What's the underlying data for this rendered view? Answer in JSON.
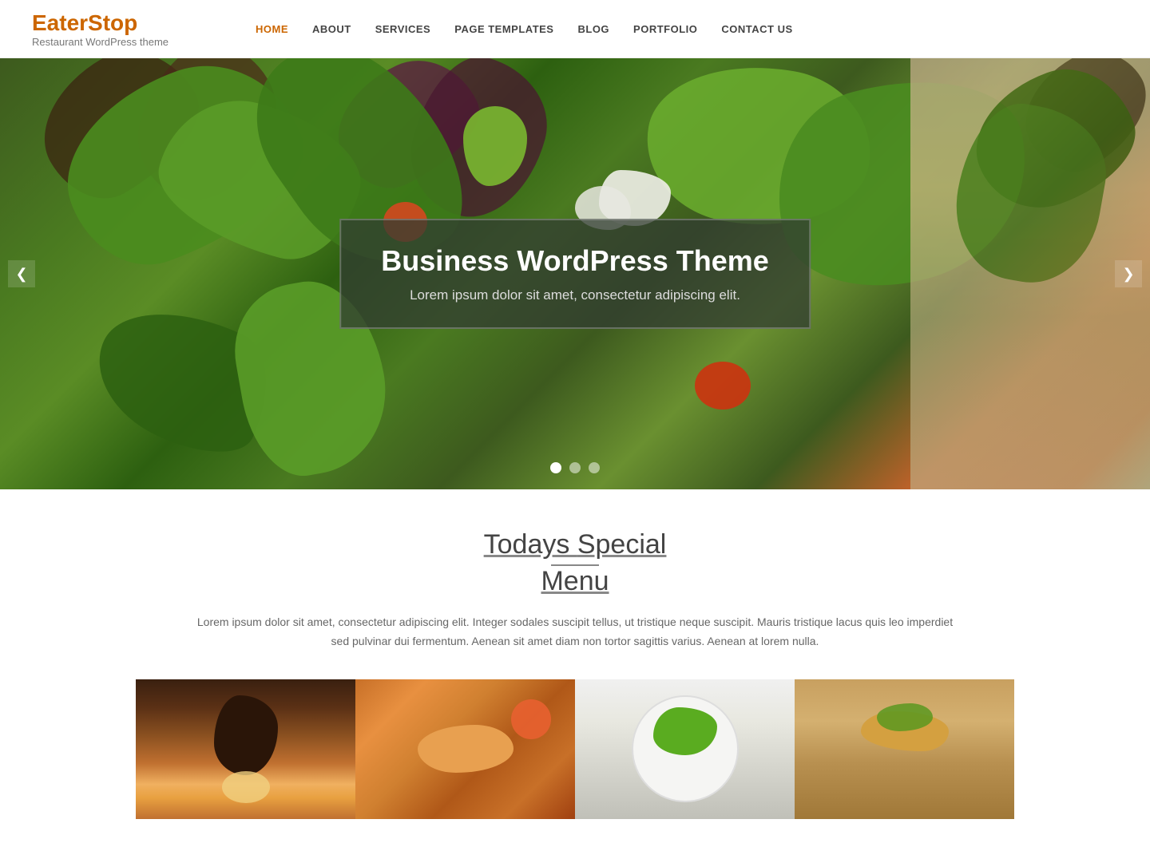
{
  "header": {
    "logo": {
      "title": "EaterStop",
      "subtitle": "Restaurant WordPress theme"
    },
    "nav": {
      "items": [
        {
          "label": "HOME",
          "active": true
        },
        {
          "label": "ABOUT",
          "active": false
        },
        {
          "label": "SERVICES",
          "active": false
        },
        {
          "label": "PAGE TEMPLATES",
          "active": false
        },
        {
          "label": "BLOG",
          "active": false
        },
        {
          "label": "PORTFOLIO",
          "active": false
        },
        {
          "label": "CONTACT US",
          "active": false
        }
      ]
    }
  },
  "slider": {
    "title": "Business WordPress Theme",
    "subtitle": "Lorem ipsum dolor sit amet, consectetur adipiscing elit.",
    "prev_arrow": "❮",
    "next_arrow": "❯",
    "dots": [
      {
        "active": true
      },
      {
        "active": false
      },
      {
        "active": false
      }
    ]
  },
  "special_menu": {
    "title_start": "Todays",
    "title_end": "Menu",
    "title_underlined": "Special",
    "description": "Lorem ipsum dolor sit amet, consectetur adipiscing elit. Integer sodales suscipit tellus, ut tristique neque suscipit. Mauris tristique lacus quis leo imperdiet sed pulvinar dui fermentum. Aenean sit amet diam non tortor sagittis varius. Aenean at lorem nulla."
  },
  "food_items": [
    {
      "id": 1,
      "alt": "Meat dish with sauce"
    },
    {
      "id": 2,
      "alt": "Salmon with orange"
    },
    {
      "id": 3,
      "alt": "Green salad on plate"
    },
    {
      "id": 4,
      "alt": "Bruschetta with toppings"
    }
  ]
}
